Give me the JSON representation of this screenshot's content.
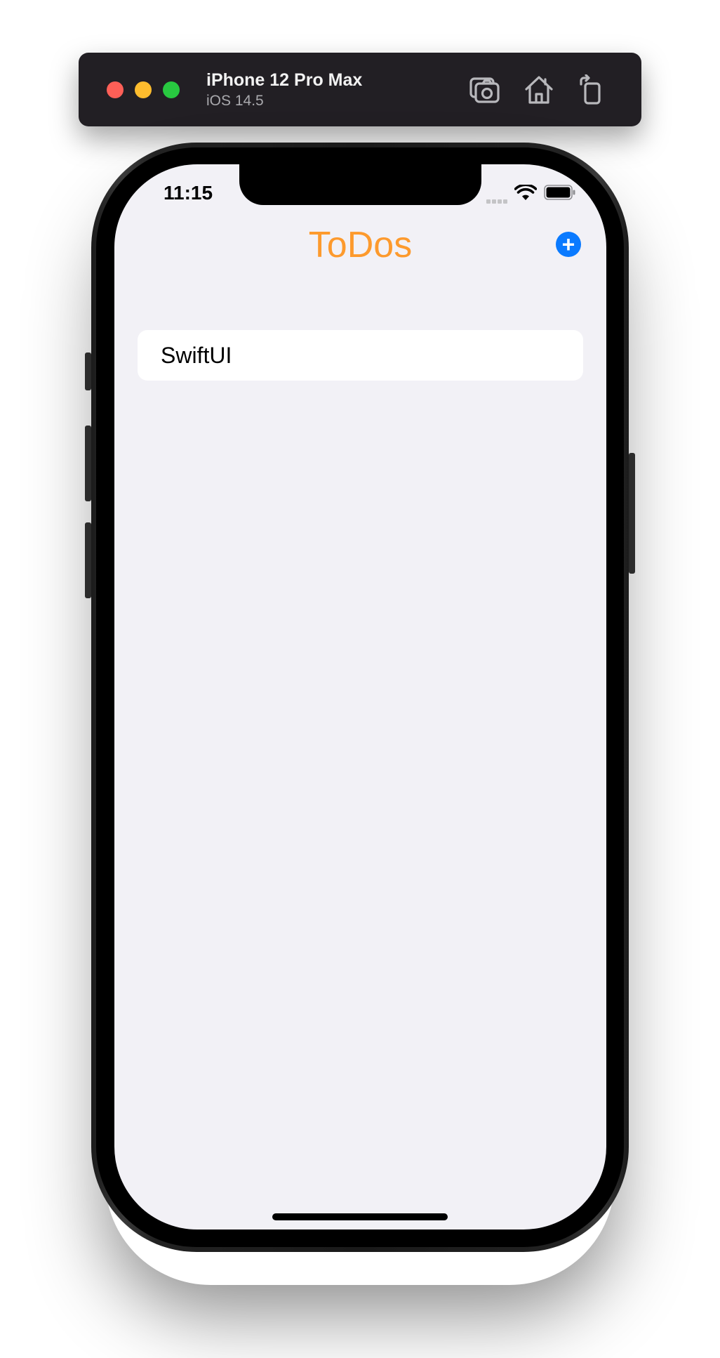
{
  "simulator": {
    "device_name": "iPhone 12 Pro Max",
    "os_version": "iOS 14.5",
    "window_controls": [
      "close-button",
      "minimize-button",
      "zoom-button"
    ],
    "toolbar_icons": [
      "screenshot-icon",
      "home-icon",
      "rotate-icon"
    ]
  },
  "status_bar": {
    "time": "11:15"
  },
  "navigation": {
    "title": "ToDos",
    "add_button_symbol": "+"
  },
  "todos": [
    {
      "title": "SwiftUI"
    }
  ],
  "colors": {
    "title": "#fd9a2d",
    "add_button": "#0a7aff",
    "screen_background": "#f2f1f6",
    "simulator_bar": "#221f24"
  }
}
